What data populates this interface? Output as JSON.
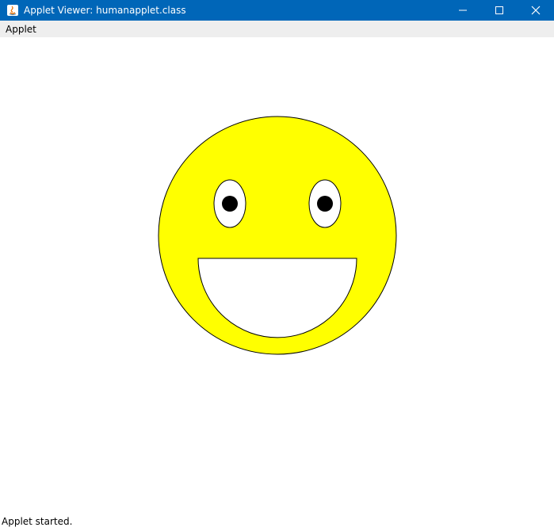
{
  "window": {
    "title": "Applet Viewer: humanapplet.class",
    "titlebar_color": "#0066b8",
    "app_icon": "java-icon",
    "controls": [
      "minimize-icon",
      "maximize-icon",
      "close-icon"
    ]
  },
  "menubar": {
    "items": [
      {
        "label": "Applet"
      }
    ]
  },
  "applet": {
    "face_color": "#ffff00",
    "eye_color": "#ffffff",
    "pupil_color": "#000000",
    "mouth_color": "#ffffff"
  },
  "status": {
    "text": "Applet started."
  }
}
